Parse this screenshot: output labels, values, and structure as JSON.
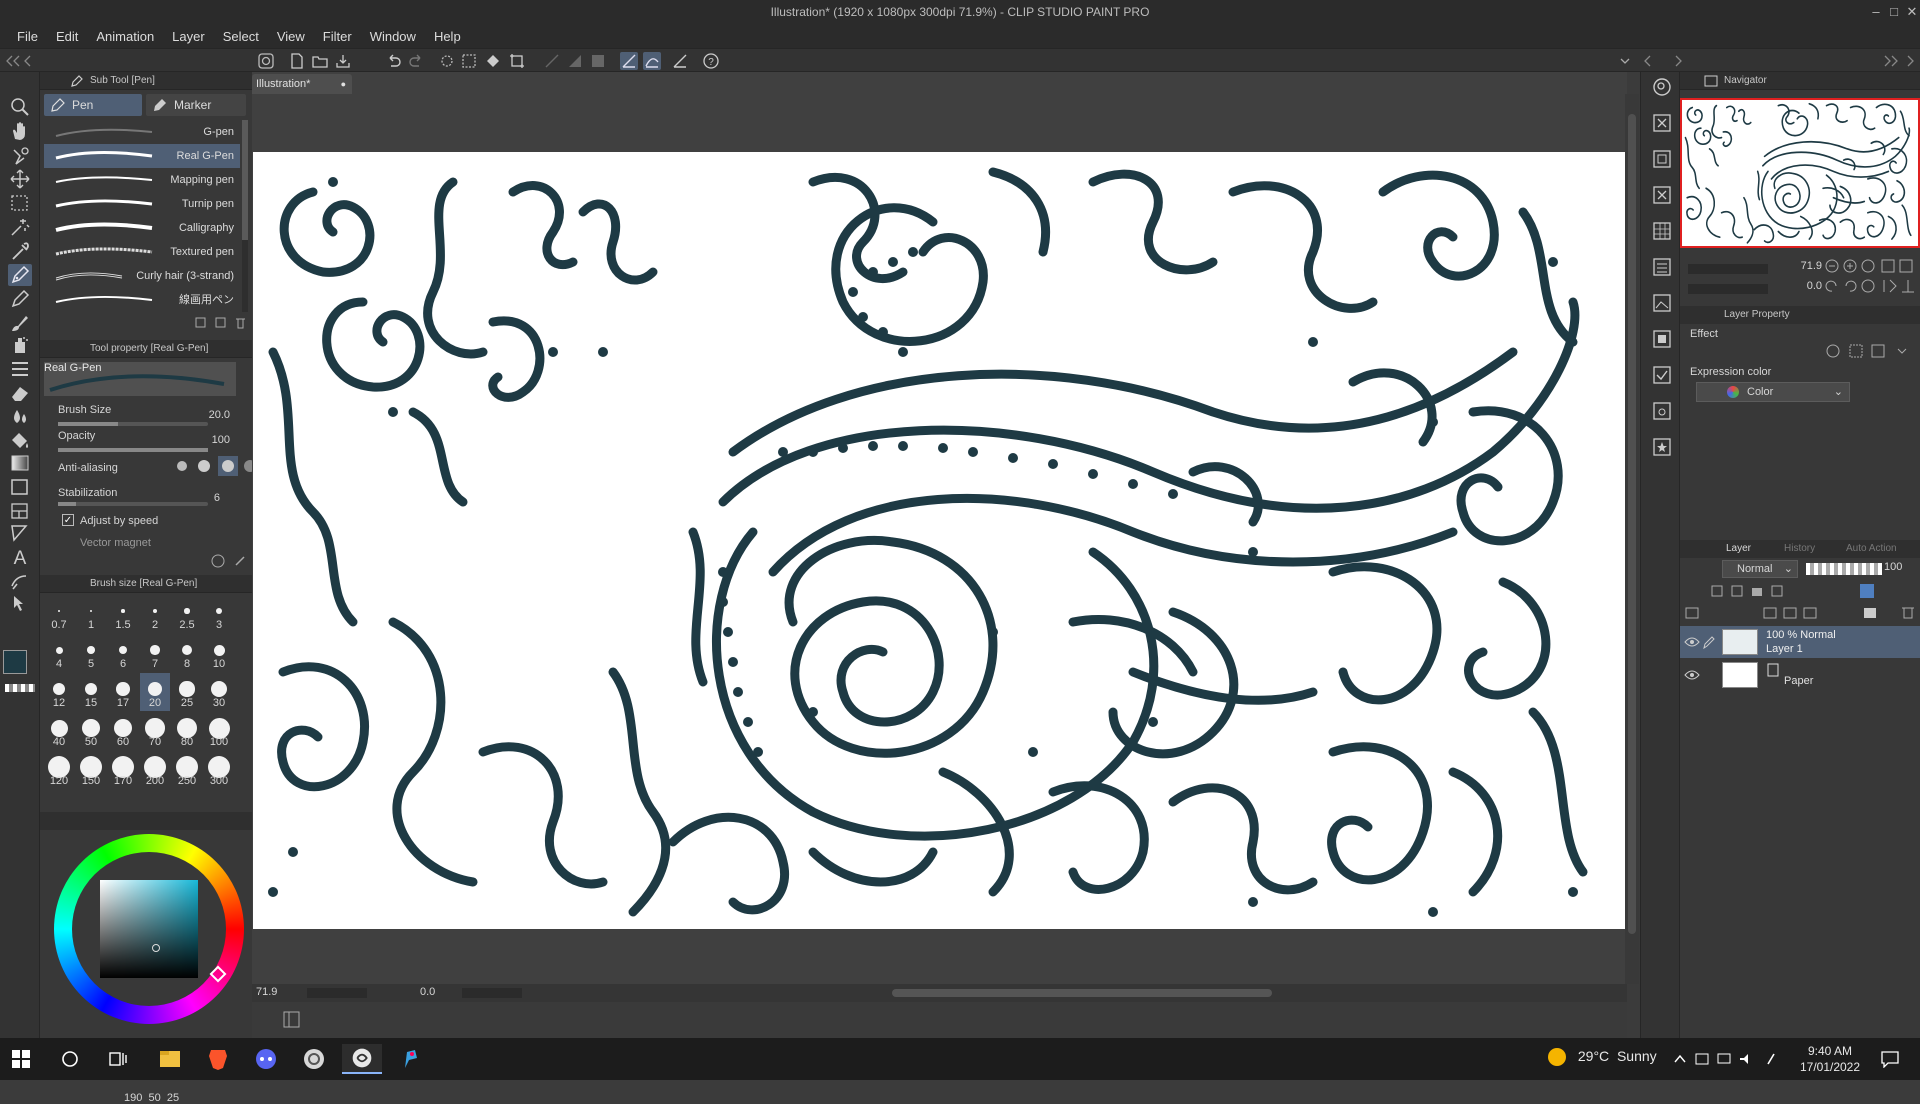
{
  "window": {
    "title": "Illustration* (1920 x 1080px 300dpi 71.9%) - CLIP STUDIO PAINT PRO"
  },
  "menu": [
    "File",
    "Edit",
    "Animation",
    "Layer",
    "Select",
    "View",
    "Filter",
    "Window",
    "Help"
  ],
  "document_tab": "Illustration*",
  "subtool": {
    "title": "Sub Tool [Pen]",
    "tabs": [
      "Pen",
      "Marker"
    ],
    "brushes": [
      "G-pen",
      "Real G-Pen",
      "Mapping pen",
      "Turnip pen",
      "Calligraphy",
      "Textured pen",
      "Curly hair (3-strand)",
      "線画用ペン"
    ],
    "selected": "Real G-Pen"
  },
  "tool_property": {
    "title": "Tool property [Real G-Pen]",
    "preview_label": "Real G-Pen",
    "brush_size_label": "Brush Size",
    "brush_size": "20.0",
    "opacity_label": "Opacity",
    "opacity": "100",
    "anti_aliasing_label": "Anti-aliasing",
    "stabilization_label": "Stabilization",
    "stabilization": "6",
    "adjust_label": "Adjust by speed",
    "vector_label": "Vector magnet"
  },
  "brush_size_panel": {
    "title": "Brush size [Real G-Pen]",
    "sizes": [
      "0.7",
      "1",
      "1.5",
      "2",
      "2.5",
      "3",
      "4",
      "5",
      "6",
      "7",
      "8",
      "10",
      "12",
      "15",
      "17",
      "20",
      "25",
      "30",
      "40",
      "50",
      "60",
      "70",
      "80",
      "100",
      "120",
      "150",
      "170",
      "200",
      "250",
      "300"
    ],
    "selected": "20"
  },
  "color": {
    "main": "#1e3a44",
    "sub": "#ffffff",
    "readout": [
      "190",
      "50",
      "25"
    ]
  },
  "status": {
    "zoom": "71.9",
    "rotation": "0.0"
  },
  "navigator": {
    "title": "Navigator",
    "zoom": "71.9",
    "rotation": "0.0"
  },
  "layer_property": {
    "title": "Layer Property",
    "effect_label": "Effect",
    "expression_label": "Expression color",
    "expression_value": "Color"
  },
  "layer_panel": {
    "tabs": [
      "Layer",
      "History",
      "Auto Action"
    ],
    "blend_mode": "Normal",
    "opacity": "100",
    "layers": [
      {
        "meta": "100 % Normal",
        "name": "Layer 1",
        "selected": true
      },
      {
        "meta": "",
        "name": "Paper",
        "selected": false
      }
    ]
  },
  "taskbar": {
    "weather_temp": "29°C",
    "weather_text": "Sunny",
    "time": "9:40 AM",
    "date": "17/01/2022"
  }
}
